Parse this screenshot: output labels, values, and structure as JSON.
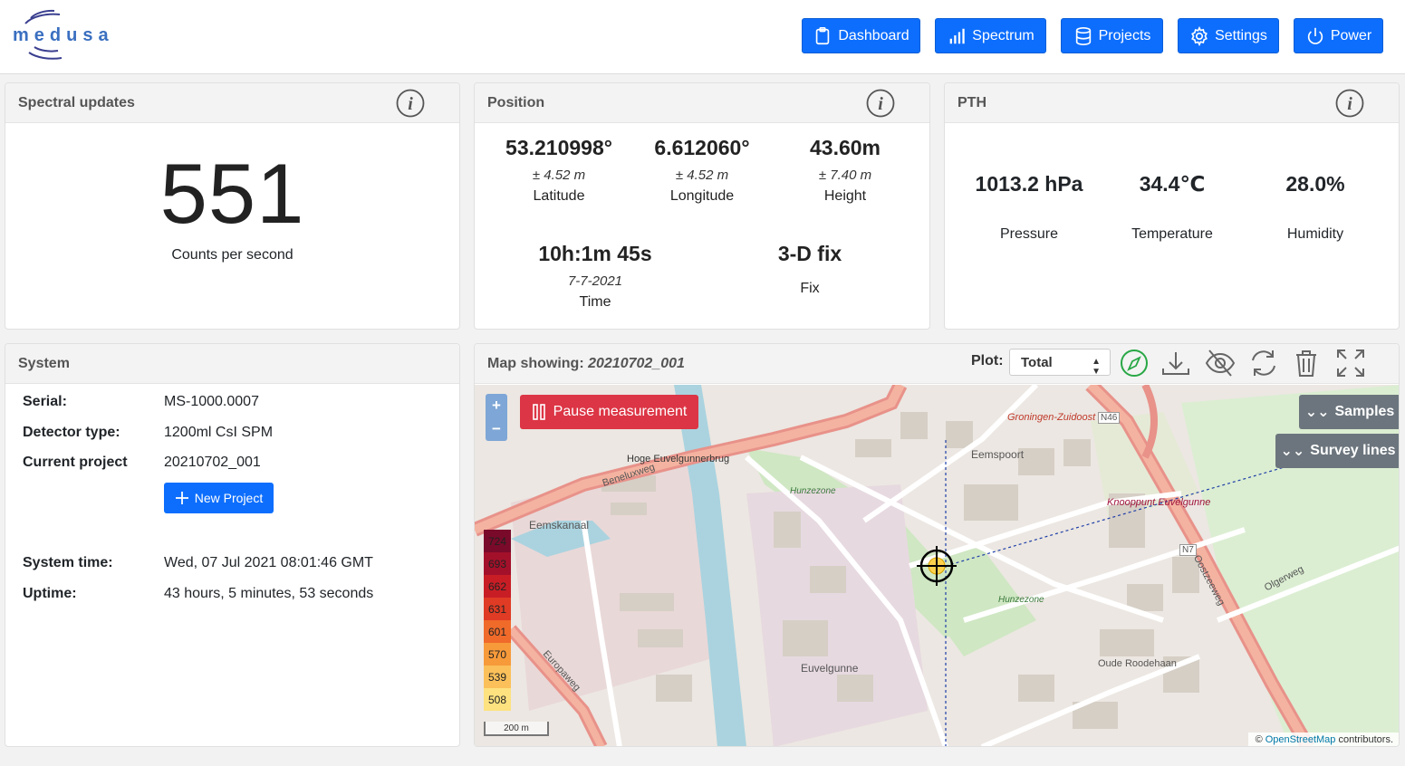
{
  "nav": {
    "dashboard": "Dashboard",
    "spectrum": "Spectrum",
    "projects": "Projects",
    "settings": "Settings",
    "power": "Power"
  },
  "logo_text": "medusa",
  "spectral": {
    "title": "Spectral updates",
    "count": "551",
    "label": "Counts per second"
  },
  "position": {
    "title": "Position",
    "latitude": {
      "value": "53.210998°",
      "accuracy": "± 4.52 m",
      "label": "Latitude"
    },
    "longitude": {
      "value": "6.612060°",
      "accuracy": "± 4.52 m",
      "label": "Longitude"
    },
    "height": {
      "value": "43.60m",
      "accuracy": "± 7.40 m",
      "label": "Height"
    },
    "time": {
      "value": "10h:1m 45s",
      "date": "7-7-2021",
      "label": "Time"
    },
    "fix": {
      "value": "3-D fix",
      "label": "Fix"
    }
  },
  "pth": {
    "title": "PTH",
    "pressure": {
      "value": "1013.2 hPa",
      "label": "Pressure"
    },
    "temperature": {
      "value": "34.4℃",
      "label": "Temperature"
    },
    "humidity": {
      "value": "28.0%",
      "label": "Humidity"
    }
  },
  "system": {
    "title": "System",
    "serial_label": "Serial:",
    "serial": "MS-1000.0007",
    "detector_label": "Detector type:",
    "detector": "1200ml CsI SPM",
    "project_label": "Current project",
    "project": "20210702_001",
    "new_project": "New Project",
    "time_label": "System time:",
    "time": "Wed, 07 Jul 2021 08:01:46 GMT",
    "uptime_label": "Uptime:",
    "uptime": "43 hours, 5 minutes, 53 seconds"
  },
  "map": {
    "title_prefix": "Map showing:",
    "project": "20210702_001",
    "plot_label": "Plot:",
    "plot_value": "Total",
    "pause": "Pause measurement",
    "samples": "Samples",
    "survey_lines": "Survey lines",
    "zoom_in": "+",
    "zoom_out": "−",
    "scale": "200 m",
    "attribution_prefix": "©",
    "attribution_link": "OpenStreetMap",
    "attribution_suffix": "contributors.",
    "legend": [
      "724",
      "693",
      "662",
      "631",
      "601",
      "570",
      "539",
      "508"
    ],
    "legend_colors": [
      "#7a0a2a",
      "#a3102a",
      "#c81d25",
      "#e03b24",
      "#f06a2a",
      "#f79a3a",
      "#fbc05a",
      "#fde27f"
    ],
    "labels": {
      "groningen": "Groningen-Zuidoost",
      "hoge": "Hoge Euvelgunnerbrug",
      "eemskanaal": "Eemskanaal",
      "eemspoort": "Eemspoort",
      "knooppunt": "Knooppunt Euvelgunne",
      "hunzezone1": "Hunzezone",
      "hunzezone2": "Hunzezone",
      "euvelgunne": "Euvelgunne",
      "oude": "Oude Roodehaan",
      "beneluxweg": "Beneluxweg",
      "europaweg": "Europaweg",
      "oostzeeweg": "Oostzeeweg",
      "olgerweg": "Olgerweg",
      "n46": "N46",
      "n7": "N7"
    }
  },
  "colors": {
    "primary": "#0d6efd",
    "danger": "#dc3545",
    "secondary": "#6c757d",
    "compass": "#28a745"
  }
}
